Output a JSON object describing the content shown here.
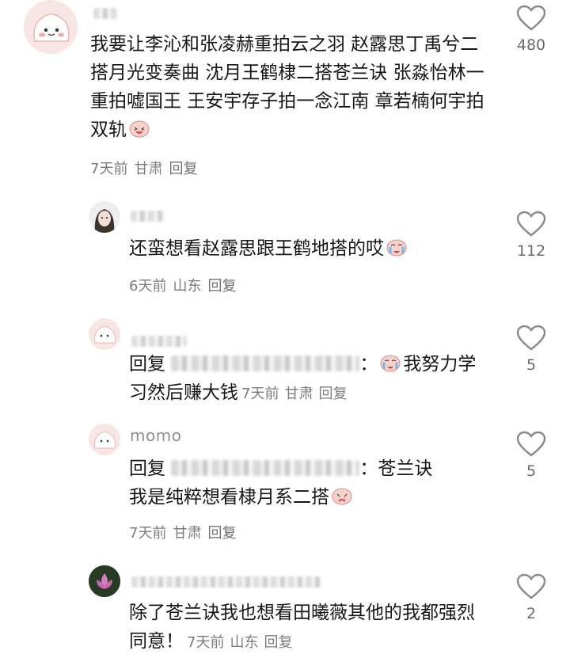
{
  "comments": [
    {
      "text": "我要让李沁和张凌赫重拍云之羽 赵露思丁禹兮二搭月光变奏曲 沈月王鹤棣二搭苍兰诀 张淼怡林一重拍嘘国王 王安宇存子拍一念江南 章若楠何宇拍双轨",
      "time": "7天前",
      "location": "甘肃",
      "reply": "回复",
      "likes": "480"
    },
    {
      "text": "还蛮想看赵露思跟王鹤地搭的哎",
      "time": "6天前",
      "location": "山东",
      "reply": "回复",
      "likes": "112"
    },
    {
      "reply_prefix": "回复",
      "colon": "：",
      "text": "我努力学习然后赚大钱",
      "time": "7天前",
      "location": "甘肃",
      "reply": "回复",
      "likes": "5"
    },
    {
      "username": "momo",
      "reply_prefix": "回复",
      "colon": "：",
      "text_line1": "苍兰诀",
      "text_line2": "我是纯粹想看棣月系二搭",
      "time": "7天前",
      "location": "甘肃",
      "reply": "回复",
      "likes": "5"
    },
    {
      "text": "除了苍兰诀我也想看田曦薇其他的我都强烈同意！",
      "time": "7天前",
      "location": "山东",
      "reply": "回复",
      "likes": "2"
    }
  ]
}
